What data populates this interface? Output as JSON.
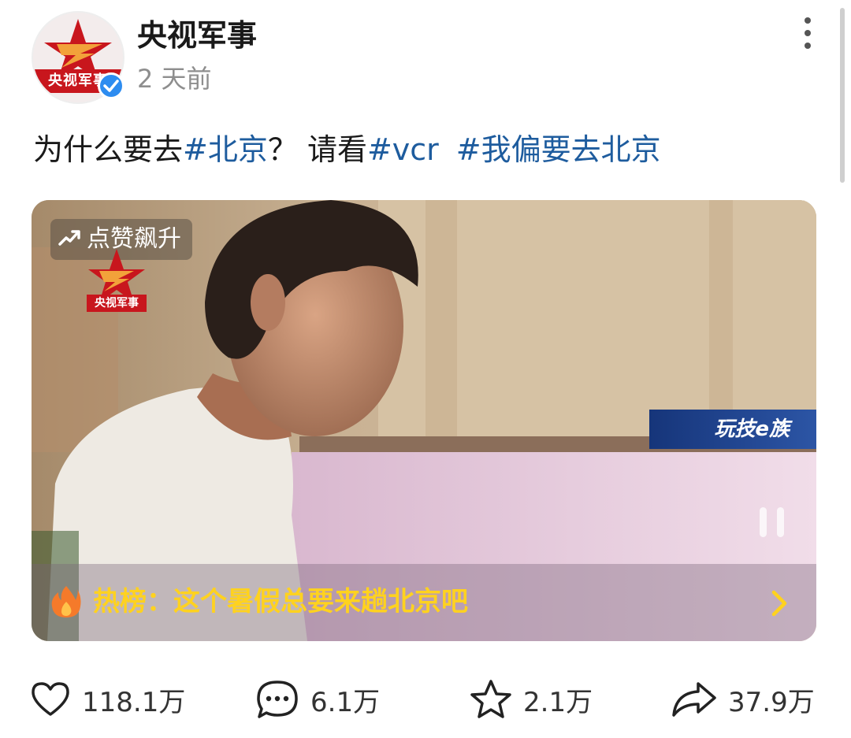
{
  "header": {
    "username": "央视军事",
    "post_time": "2 天前",
    "avatar_text": "央视军事"
  },
  "post": {
    "text_1": "为什么要去",
    "tag_1": "#北京",
    "text_2": "？ 请看",
    "tag_2": "#vcr",
    "tag_3": "#我偏要去北京"
  },
  "video": {
    "like_rising_label": "点赞飙升",
    "channel_logo_text": "央视军事",
    "watermark": "玩技e族",
    "hot_label": "热榜：",
    "hot_topic": "这个暑假总要来趟北京吧"
  },
  "actions": {
    "likes": "118.1万",
    "comments": "6.1万",
    "favorites": "2.1万",
    "shares": "37.9万"
  },
  "colors": {
    "tag": "#1e5c9e",
    "hot_text": "#ffd21f",
    "verified": "#2d8cf0",
    "brand_red": "#c8161d"
  },
  "icons": [
    "more-icon",
    "verified-icon",
    "trend-up-icon",
    "flame-icon",
    "pause-icon",
    "chevron-right-icon",
    "heart-icon",
    "comment-icon",
    "star-icon",
    "share-icon"
  ]
}
